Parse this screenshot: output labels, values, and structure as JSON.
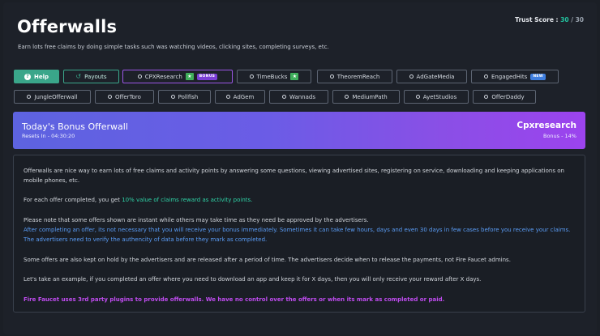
{
  "header": {
    "title": "Offerwalls",
    "subtitle": "Earn lots free claims by doing simple tasks such was watching videos, clicking sites, completing surveys, etc.",
    "trust_label": "Trust Score : ",
    "trust_value": "30",
    "trust_sep": " / ",
    "trust_max": "30"
  },
  "buttons": {
    "help": "Help",
    "payouts": "Payouts",
    "row1": [
      "CPXResearch",
      "TimeBucks",
      "TheoremReach",
      "AdGateMedia",
      "EngagedHits"
    ],
    "row2": [
      "JungleOfferwall",
      "OfferToro",
      "Pollfish",
      "AdGem",
      "Wannads",
      "MediumPath",
      "AyetStudios",
      "OfferDaddy"
    ],
    "bonus_tag": "BONUS",
    "new_tag": "NEW"
  },
  "banner": {
    "title": "Today's Bonus Offerwall",
    "resets": "Resets In - 04:30:20",
    "name": "Cpxresearch",
    "bonus": "Bonus - 14%"
  },
  "info": {
    "p1": "Offerwalls are nice way to earn lots of free claims and activity points by answering some questions, viewing advertised sites, registering on service, downloading and keeping applications on mobile phones, etc.",
    "p2_pre": "For each offer completed, you get ",
    "p2_hl": "10% value of claims reward as activity points.",
    "p3": "Please note that some offers shown are instant while others may take time as they need be approved by the advertisers.",
    "p4": "After completing an offer, its not necessary that you will receive your bonus immediately. Sometimes it can take few hours, days and even 30 days in few cases before you receive your claims. The advertisers need to verify the authencity of data before they mark as completed.",
    "p5": "Some offers are also kept on hold by the advertisers and are released after a period of time. The advertisers decide when to release the payments, not Fire Faucet admins.",
    "p6": "Let's take an example, if you completed an offer where you need to download an app and keep it for X days, then you will only receive your reward after X days.",
    "p7": "Fire Faucet uses 3rd party plugins to provide offerwalls. We have no control over the offers or when its mark as completed or paid."
  },
  "colors": {
    "accent_green": "#3aa68a",
    "highlight_teal": "#2fd2a6",
    "blue_text": "#5a9cf5",
    "purple_text": "#c04cf0",
    "banner_start": "#5d63e0",
    "banner_end": "#9c43ee"
  },
  "icons": {
    "help": "question-circle-icon",
    "payouts": "history-icon",
    "radio": "radio-circle-icon",
    "featured": "star-icon"
  }
}
